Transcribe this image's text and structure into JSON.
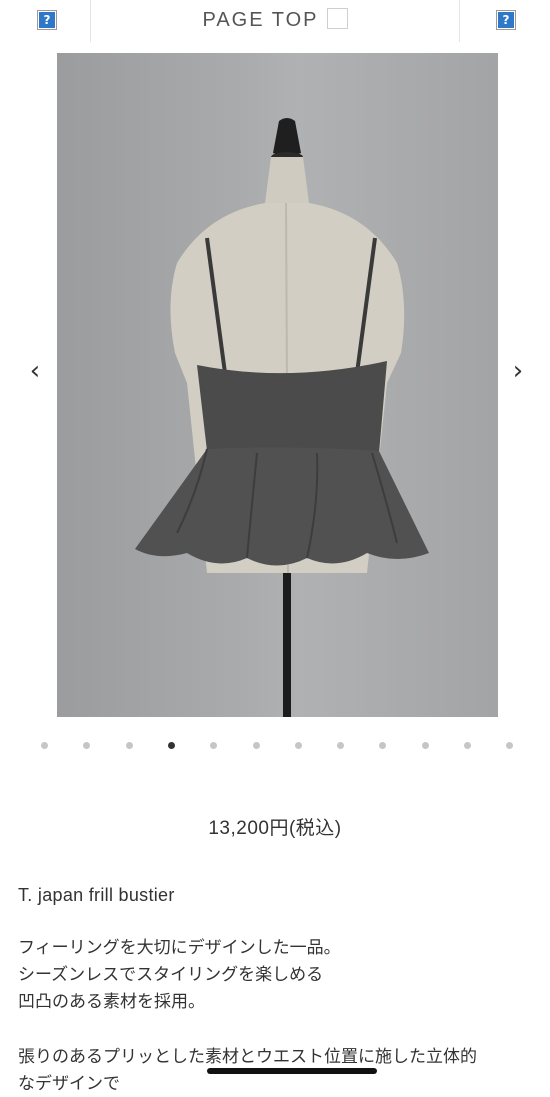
{
  "header": {
    "page_top_label": "PAGE TOP",
    "left_icon": "question-icon",
    "right_icon": "question-icon",
    "icon_glyph": "?"
  },
  "gallery": {
    "image_alt": "gray frill bustier on dress form, back view",
    "prev_glyph": "‹",
    "next_glyph": "›",
    "slide_count": 12,
    "active_index": 3
  },
  "product": {
    "price": "13,200円(税込)",
    "name": "T. japan frill bustier",
    "description_lines": [
      "フィーリングを大切にデザインした一品。",
      "シーズンレスでスタイリングを楽しめる",
      "凹凸のある素材を採用。"
    ],
    "description_line_4": "張りのあるプリッとした素材とウエスト位置に施した立体的",
    "description_line_5": "なデザインで"
  },
  "colors": {
    "icon_blue": "#2f77c9",
    "dot_active": "#333333",
    "dot_inactive": "#c6c6c6"
  }
}
